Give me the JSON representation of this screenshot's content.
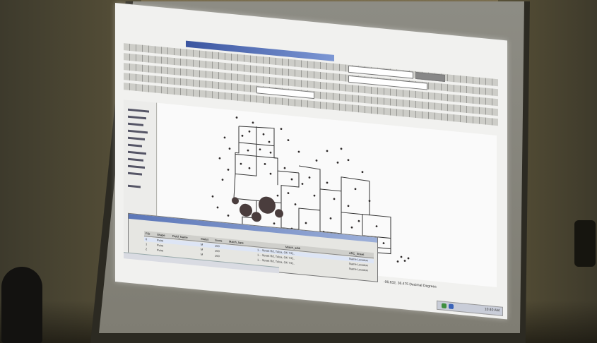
{
  "scene": {
    "projected_app": "ArcMap",
    "colors": {
      "room_wall": "#585139",
      "screen_surface": "#f1f1ef",
      "window_title_blue": "#3b55a0",
      "map_points": "#2e2a2a",
      "county_border": "#333333"
    }
  },
  "app": {
    "attribute_table": {
      "columns": [
        "FID",
        "Shape",
        "Field_Name",
        "Status",
        "Score",
        "Match_type",
        "Match_addr",
        "ARC_Street"
      ],
      "rows": [
        {
          "fid": "0",
          "shape": "Point",
          "status": "M",
          "score": "100",
          "match_addr": "1... Street Rd, Tulsa, OK 741..",
          "arc_street": "Name Location"
        },
        {
          "fid": "1",
          "shape": "Point",
          "status": "M",
          "score": "100",
          "match_addr": "1... Street Rd, Tulsa, OK 741..",
          "arc_street": "Name Location"
        },
        {
          "fid": "2",
          "shape": "Point",
          "status": "M",
          "score": "100",
          "match_addr": "1... Street Rd, Tulsa, OK 741..",
          "arc_street": "Name Location"
        }
      ]
    },
    "status_bar": {
      "coordinates": "-96.632, 36.475 Decimal Degrees"
    },
    "taskbar": {
      "clock": "10:40 AM"
    }
  }
}
